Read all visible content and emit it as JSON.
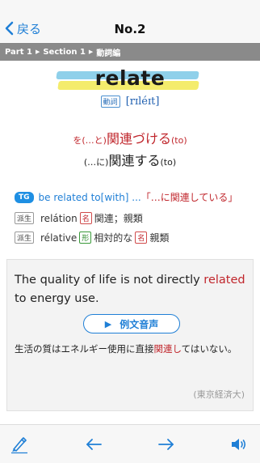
{
  "nav": {
    "back_label": "戻る",
    "title": "No.2"
  },
  "breadcrumb": {
    "part": "Part 1",
    "section": "Section 1",
    "category": "動詞編"
  },
  "entry": {
    "headword": "relate",
    "pos_tag": "動詞",
    "pronunciation": "[rɪléɪt]",
    "meaning1_a": "を(…と)",
    "meaning1_b": "関連づける",
    "meaning1_c": "(to)",
    "meaning2_a": "(…に)",
    "meaning2_b": "関連する",
    "meaning2_c": "(to)"
  },
  "phrase": {
    "tag": "TG",
    "text": "be related to[with] ...",
    "gloss": "「…に関連している」"
  },
  "derivatives": [
    {
      "tag": "派生",
      "word": "relátion",
      "pos": "名",
      "meaning": "関連；親類"
    },
    {
      "tag": "派生",
      "word": "rélative",
      "pos": "形",
      "meaning": "相対的な",
      "pos2": "名",
      "meaning2": "親類"
    }
  ],
  "example": {
    "en_before": "The quality of life is not directly ",
    "en_hit": "related",
    "en_after": " to energy use.",
    "audio_label": "例文音声",
    "jp_before": "生活の質はエネルギー使用に直接",
    "jp_hit": "関連し",
    "jp_after": "てはいない。",
    "source": "(東京経済大)"
  },
  "colors": {
    "accent": "#1f7fd6",
    "highlight_red": "#c0262c",
    "marker_blue": "#8fd0ea",
    "marker_yellow": "#f4ec6c"
  },
  "icons": {
    "back": "chevron-left-icon",
    "toolbar": [
      "marker-pen-icon",
      "arrow-left-icon",
      "arrow-right-icon",
      "speaker-icon"
    ]
  }
}
